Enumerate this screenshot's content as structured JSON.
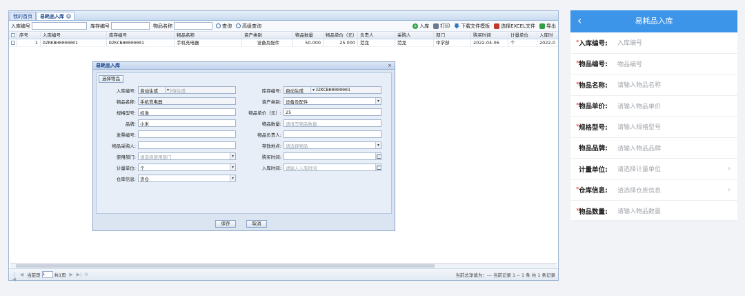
{
  "app": {
    "tabs": [
      {
        "label": "我的首页"
      },
      {
        "label": "易耗品入库",
        "active": true
      }
    ],
    "toolbar": {
      "filters": [
        {
          "label": "入库编号",
          "value": ""
        },
        {
          "label": "库存编号",
          "value": ""
        },
        {
          "label": "物品名称",
          "value": ""
        }
      ],
      "query_label": "查询",
      "advanced_query_label": "高级查询",
      "actions": [
        {
          "label": "入库",
          "icon": "add-icon"
        },
        {
          "label": "打印",
          "icon": "print-icon"
        },
        {
          "label": "下载文件模板",
          "icon": "download-icon"
        },
        {
          "label": "选择EXCEL文件",
          "icon": "excel-icon"
        },
        {
          "label": "导出",
          "icon": "export-icon"
        }
      ]
    },
    "grid": {
      "columns": [
        "序号",
        "入库编号",
        "库存编号",
        "物品名称",
        "资产类别",
        "物品数量",
        "物品单价（元）",
        "负责人",
        "采购人",
        "部门",
        "购买时间",
        "计量单位",
        "入库时"
      ],
      "rows": [
        [
          "1",
          "DZRKBH0000001",
          "DZKCBH0000001",
          "手机充电器",
          "设备及配件",
          "50.000",
          "25.000",
          "范龙",
          "范龙",
          "中学部",
          "2022-04-06",
          "个",
          "2022-0"
        ]
      ]
    },
    "pager": {
      "current_label": "当前页",
      "page": "1",
      "total_label": "共1页",
      "info": "当前总净值为：---  当前记录 1 -- 1 条 共 1 条记录"
    }
  },
  "dialog": {
    "title": "易耗品入库",
    "pick_button": "选择物品",
    "left_fields": [
      {
        "label": "入库编号:",
        "value": "自动生成",
        "placeholder": "等待生成",
        "kind": "auto"
      },
      {
        "label": "物品名称:",
        "value": "手机充电器",
        "kind": "ro"
      },
      {
        "label": "规格型号:",
        "value": "标准",
        "kind": "text"
      },
      {
        "label": "品牌:",
        "value": "小米",
        "kind": "text"
      },
      {
        "label": "发票编号:",
        "value": "",
        "kind": "text"
      },
      {
        "label": "物品采购人:",
        "value": "",
        "kind": "text"
      },
      {
        "label": "使用部门:",
        "value": "",
        "placeholder": "请选择使用部门",
        "kind": "select"
      },
      {
        "label": "计量单位:",
        "value": "个",
        "kind": "select"
      },
      {
        "label": "仓库信息:",
        "value": "货仓",
        "kind": "select"
      }
    ],
    "right_fields": [
      {
        "label": "库存编号:",
        "value": "自动生成",
        "extra": "DZKCBH0000001",
        "kind": "auto"
      },
      {
        "label": "资产类别:",
        "value": "设备及配件",
        "kind": "select"
      },
      {
        "label": "物品单价（元）:",
        "value": "25",
        "kind": "text"
      },
      {
        "label": "物品数量:",
        "value": "",
        "placeholder": "请填写物品数量",
        "kind": "text"
      },
      {
        "label": "物品负责人:",
        "value": "",
        "kind": "text"
      },
      {
        "label": "存放地点:",
        "value": "",
        "placeholder": "请选择物品",
        "kind": "select"
      },
      {
        "label": "购买时间:",
        "value": "",
        "kind": "date"
      },
      {
        "label": "入库时间:",
        "value": "",
        "placeholder": "请输入入库时间",
        "kind": "date"
      }
    ],
    "save_label": "保存",
    "cancel_label": "取消"
  },
  "mobile": {
    "title": "易耗品入库",
    "fields": [
      {
        "label": "入库编号:",
        "placeholder": "入库编号",
        "required": true,
        "chevron": false
      },
      {
        "label": "物品编号:",
        "placeholder": "物品编号",
        "required": true,
        "chevron": false
      },
      {
        "label": "物品名称:",
        "placeholder": "请输入物品名称",
        "required": true,
        "chevron": false
      },
      {
        "label": "物品单价:",
        "placeholder": "请输入物品单价",
        "required": true,
        "chevron": false
      },
      {
        "label": "规格型号:",
        "placeholder": "请输入规格型号",
        "required": true,
        "chevron": false
      },
      {
        "label": "物品品牌:",
        "placeholder": "请输入物品品牌",
        "required": false,
        "chevron": false
      },
      {
        "label": "计量单位:",
        "placeholder": "请选择计量单位",
        "required": false,
        "chevron": true
      },
      {
        "label": "仓库信息:",
        "placeholder": "请选择仓库信息",
        "required": true,
        "chevron": true
      },
      {
        "label": "物品数量:",
        "placeholder": "请输入物品数量",
        "required": true,
        "chevron": false
      }
    ],
    "accent_color": "#3d95ea",
    "required_color": "#e53935"
  }
}
